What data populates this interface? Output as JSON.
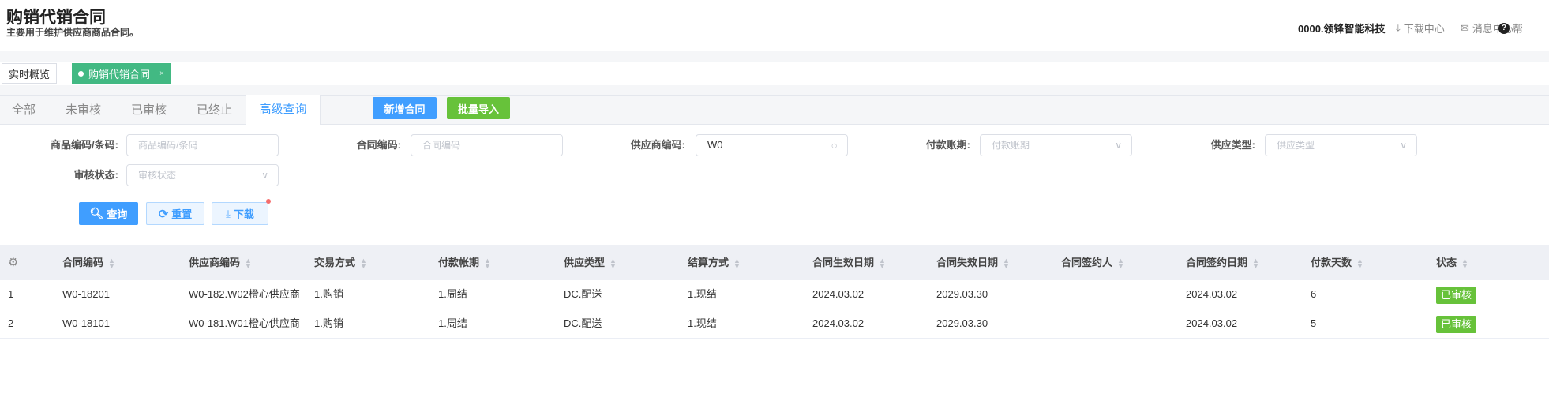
{
  "page": {
    "title": "购销代销合同",
    "subtitle": "主要用于维护供应商商品合同。"
  },
  "header": {
    "company": "0000.领锋智能科技",
    "download_center": "下载中心",
    "message_center": "消息中心",
    "help": "帮"
  },
  "tags": [
    {
      "label": "实时概览"
    },
    {
      "label": "购销代销合同",
      "close": "×"
    }
  ],
  "tabs": [
    "全部",
    "未审核",
    "已审核",
    "已终止",
    "高级查询"
  ],
  "actions": {
    "add": "新增合同",
    "import": "批量导入"
  },
  "filters": {
    "product_code": {
      "label": "商品编码/条码:",
      "placeholder": "商品编码/条码"
    },
    "contract_code": {
      "label": "合同编码:",
      "placeholder": "合同编码"
    },
    "supplier_code": {
      "label": "供应商编码:",
      "value": "W0"
    },
    "payment_term": {
      "label": "付款账期:",
      "placeholder": "付款账期"
    },
    "supply_type": {
      "label": "供应类型:",
      "placeholder": "供应类型"
    },
    "audit_status": {
      "label": "审核状态:",
      "placeholder": "审核状态"
    }
  },
  "buttons": {
    "search": "查询",
    "reset": "重置",
    "download": "下载"
  },
  "table": {
    "columns": [
      "合同编码",
      "供应商编码",
      "交易方式",
      "付款帐期",
      "供应类型",
      "结算方式",
      "合同生效日期",
      "合同失效日期",
      "合同签约人",
      "合同签约日期",
      "付款天数",
      "状态"
    ],
    "rows": [
      [
        "1",
        "W0-18201",
        "W0-182.W02橙心供应商",
        "1.购销",
        "1.周结",
        "DC.配送",
        "1.现结",
        "2024.03.02",
        "2029.03.30",
        "",
        "2024.03.02",
        "6",
        "已审核"
      ],
      [
        "2",
        "W0-18101",
        "W0-181.W01橙心供应商",
        "1.购销",
        "1.周结",
        "DC.配送",
        "1.现结",
        "2024.03.02",
        "2029.03.30",
        "",
        "2024.03.02",
        "5",
        "已审核"
      ]
    ]
  }
}
